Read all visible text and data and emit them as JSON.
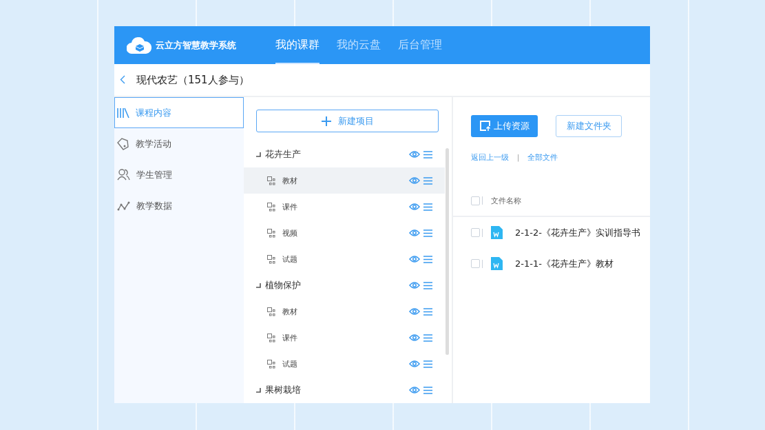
{
  "header": {
    "logo_text": "云立方智慧教学系统",
    "nav": [
      {
        "label": "我的课群",
        "selected": true
      },
      {
        "label": "我的云盘",
        "selected": false
      },
      {
        "label": "后台管理",
        "selected": false
      }
    ]
  },
  "course_title": "现代农艺（151人参与）",
  "sidebar": {
    "items": [
      {
        "label": "课程内容",
        "selected": true
      },
      {
        "label": "教学活动",
        "selected": false
      },
      {
        "label": "学生管理",
        "selected": false
      },
      {
        "label": "教学数据",
        "selected": false
      }
    ]
  },
  "outline": {
    "new_button": "新建项目",
    "items": [
      {
        "label": "花卉生产",
        "selected": false,
        "children": [
          {
            "label": "教材",
            "selected": true
          },
          {
            "label": "课件",
            "selected": false
          },
          {
            "label": "视频",
            "selected": false
          },
          {
            "label": "试题",
            "selected": false
          }
        ]
      },
      {
        "label": "植物保护",
        "selected": false,
        "children": [
          {
            "label": "教材",
            "selected": false
          },
          {
            "label": "课件",
            "selected": false
          },
          {
            "label": "试题",
            "selected": false
          }
        ]
      },
      {
        "label": "果树栽培",
        "selected": false
      }
    ]
  },
  "files": {
    "upload_button": "上传资源",
    "new_folder_button": "新建文件夹",
    "links": [
      "返回上一级",
      "全部文件"
    ],
    "separator": "|",
    "columns": [
      {
        "label": "文件名称"
      }
    ],
    "header_checked": false,
    "rows": [
      {
        "name": "2-1-2-《花卉生产》实训指导书",
        "checked": false
      },
      {
        "name": "2-1-1-《花卉生产》教材",
        "checked": false
      }
    ]
  }
}
